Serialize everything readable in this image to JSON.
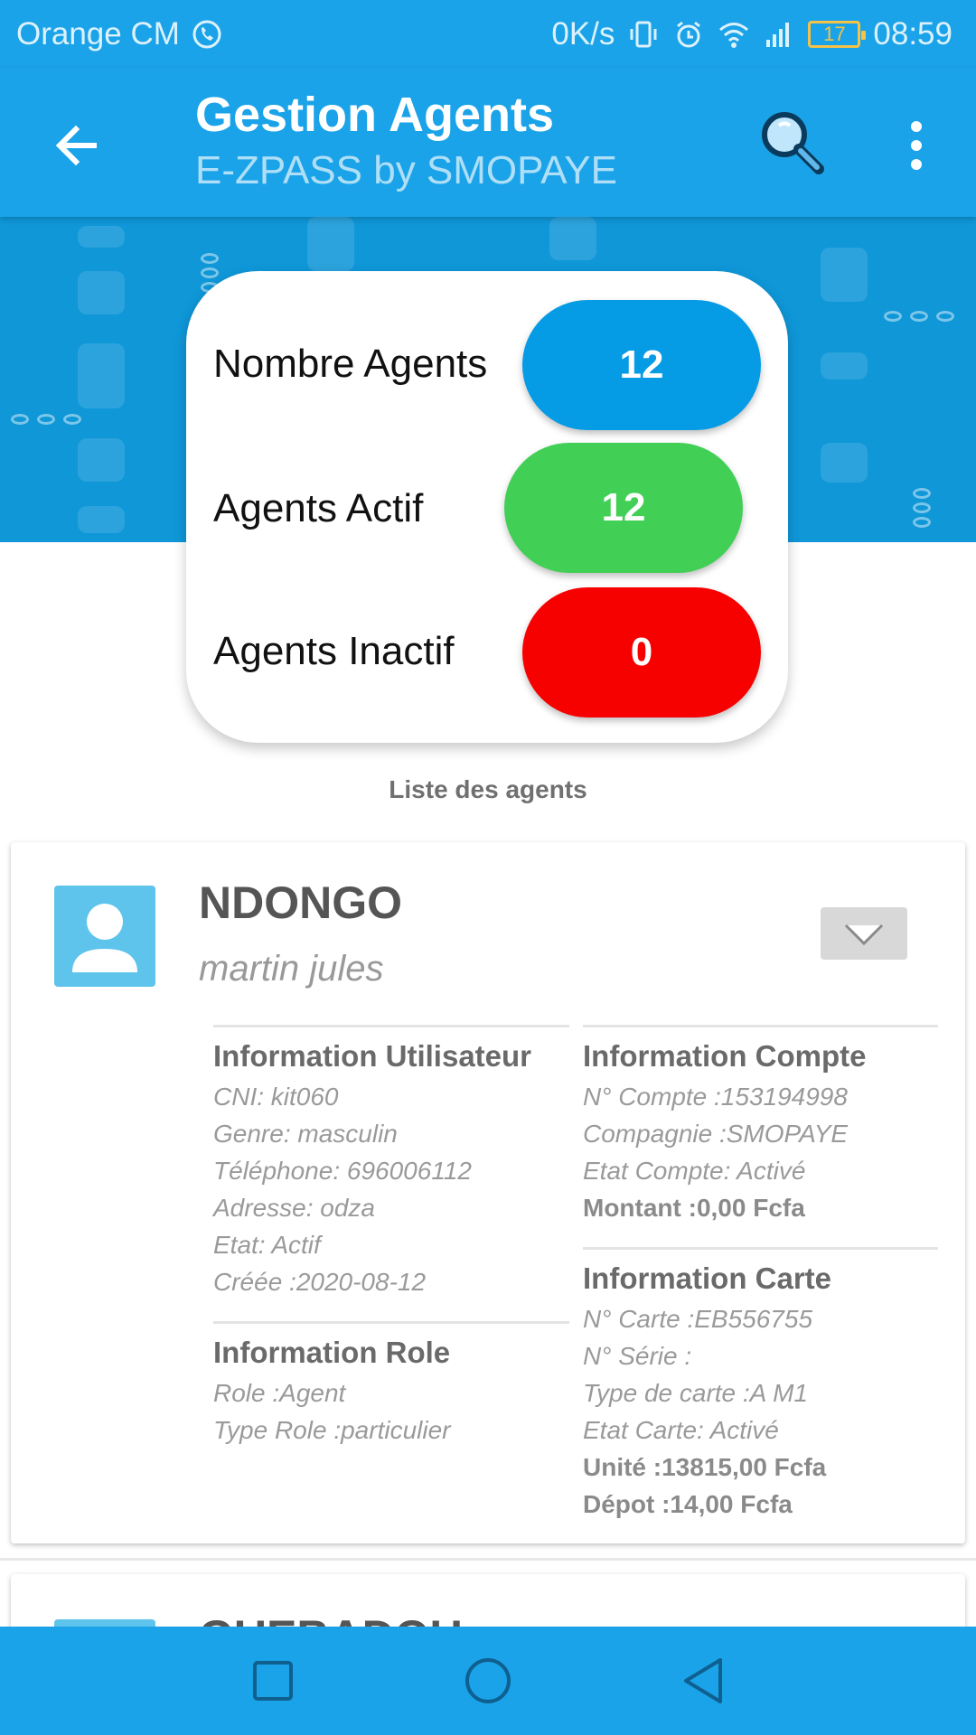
{
  "status_bar": {
    "carrier": "Orange CM",
    "speed": "0K/s",
    "battery": "17",
    "time": "08:59"
  },
  "app_bar": {
    "title": "Gestion Agents",
    "subtitle": "E-ZPASS by SMOPAYE"
  },
  "stats": {
    "total_label": "Nombre Agents",
    "total_value": "12",
    "active_label": "Agents Actif",
    "active_value": "12",
    "inactive_label": "Agents Inactif",
    "inactive_value": "0"
  },
  "list_title": "Liste des agents",
  "agents": [
    {
      "lastname": "NDONGO",
      "firstname": "martin jules",
      "user_info": {
        "title": "Information Utilisateur",
        "cni": "CNI: kit060",
        "genre": "Genre: masculin",
        "telephone": "Téléphone: 696006112",
        "adresse": "Adresse: odza",
        "etat": "Etat: Actif",
        "creee": "Créée :2020-08-12"
      },
      "role_info": {
        "title": "Information Role",
        "role": "Role :Agent",
        "type_role": "Type Role :particulier"
      },
      "account_info": {
        "title": "Information Compte",
        "numero": "N° Compte :153194998",
        "compagnie": "Compagnie :SMOPAYE",
        "etat": "Etat Compte: Activé",
        "montant": "Montant :0,00 Fcfa"
      },
      "card_info": {
        "title": "Information Carte",
        "numero": "N° Carte :EB556755",
        "serie": "N° Série :",
        "type": "Type de carte :A M1",
        "etat": "Etat Carte: Activé",
        "unite": "Unité :13815,00 Fcfa",
        "depot": "Dépot :14,00 Fcfa"
      }
    },
    {
      "lastname": "GUEBADOU"
    }
  ],
  "colors": {
    "primary": "#1aa3e8",
    "banner": "#0f97d8",
    "total_pill": "#059be5",
    "active_pill": "#41cf55",
    "inactive_pill": "#f70000",
    "avatar": "#5ec4ec"
  }
}
